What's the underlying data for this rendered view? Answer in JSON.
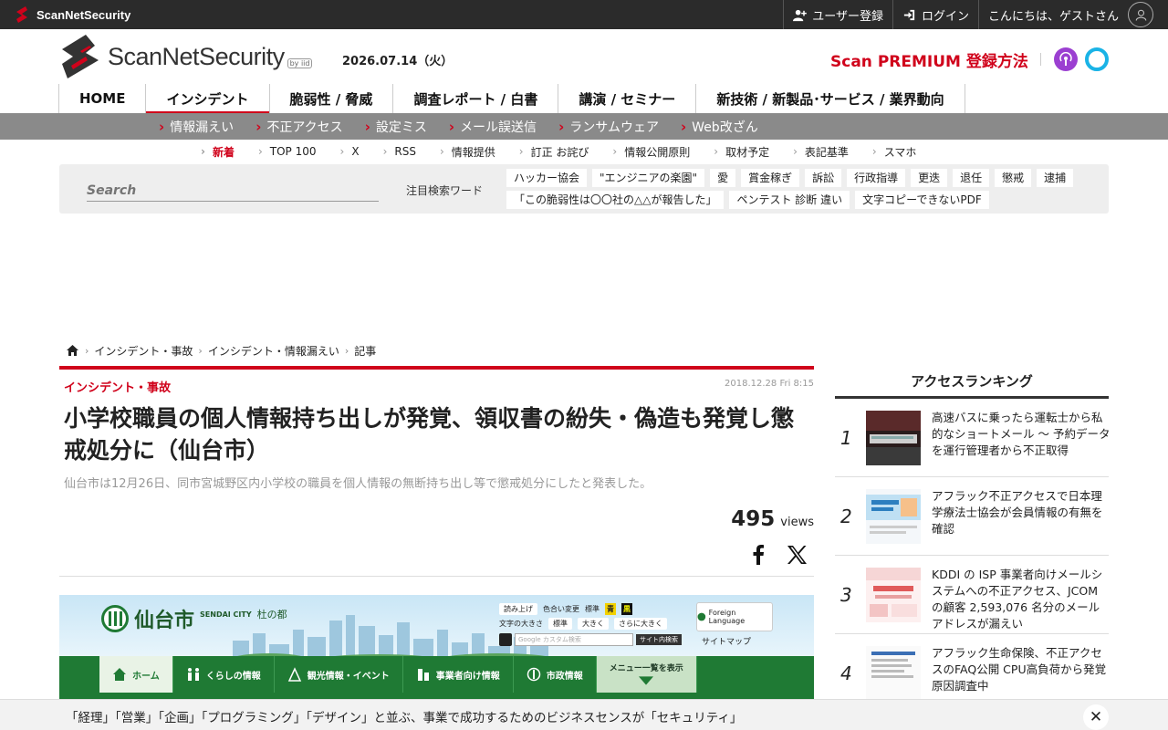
{
  "topbar": {
    "brand": "ScanNetSecurity",
    "register": "ユーザー登録",
    "login": "ログイン",
    "greeting": "こんにちは、ゲストさん"
  },
  "header": {
    "logo_text": "ScanNetSecurity",
    "logo_by": "by iid",
    "date": "2026.07.14（火）",
    "premium": "Scan PREMIUM 登録方法"
  },
  "main_nav": [
    "HOME",
    "インシデント",
    "脆弱性 / 脅威",
    "調査レポート / 白書",
    "講演 / セミナー",
    "新技術 / 新製品･サービス / 業界動向"
  ],
  "sub_nav": [
    "情報漏えい",
    "不正アクセス",
    "設定ミス",
    "メール誤送信",
    "ランサムウェア",
    "Web改ざん"
  ],
  "link_nav": [
    "新着",
    "TOP 100",
    "X",
    "RSS",
    "情報提供",
    "訂正 お詫び",
    "情報公開原則",
    "取材予定",
    "表記基準",
    "スマホ"
  ],
  "search": {
    "placeholder": "Search",
    "keyword_label": "注目検索ワード",
    "keywords": [
      "ハッカー協会",
      "\"エンジニアの楽園\"",
      "愛",
      "賞金稼ぎ",
      "訴訟",
      "行政指導",
      "更迭",
      "退任",
      "懲戒",
      "逮捕",
      "「この脆弱性は〇〇社の△△が報告した」",
      "ペンテスト 診断 違い",
      "文字コピーできないPDF"
    ]
  },
  "breadcrumb": [
    "インシデント・事故",
    "インシデント・情報漏えい",
    "記事"
  ],
  "article": {
    "category": "インシデント・事故",
    "timestamp": "2018.12.28 Fri 8:15",
    "title": "小学校職員の個人情報持ち出しが発覚、領収書の紛失・偽造も発覚し懲戒処分に（仙台市）",
    "lead": "仙台市は12月26日、同市宮城野区内小学校の職員を個人情報の無断持ち出し等で懲戒処分にしたと発表した。",
    "views_count": "495",
    "views_unit": "views"
  },
  "article_image": {
    "city_name": "仙台市",
    "city_en": "SENDAI CITY",
    "city_motto": "杜の都",
    "read_aloud": "読み上げ",
    "color_change": "色合い変更",
    "standard": "標準",
    "yellow": "青",
    "black": "黒",
    "font_size": "文字の大きさ",
    "size_standard": "標準",
    "size_large": "大きく",
    "size_larger": "さらに大きく",
    "search_placeholder": "Google カスタム検索",
    "search_button": "サイト内検索",
    "foreign_language": "Foreign Language",
    "sitemap": "サイトマップ",
    "nav": [
      "ホーム",
      "くらしの情報",
      "観光情報・イベント",
      "事業者向け情報",
      "市政情報",
      "メニュー一覧を表示"
    ]
  },
  "ranking": {
    "title": "アクセスランキング",
    "items": [
      {
        "rank": "1",
        "text": "高速バスに乗ったら運転士から私的なショートメール 〜 予約データを運行管理者から不正取得"
      },
      {
        "rank": "2",
        "text": "アフラック不正アクセスで日本理学療法士協会が会員情報の有無を確認"
      },
      {
        "rank": "3",
        "text": "KDDI の ISP 事業者向けメールシステムへの不正アクセス、JCOM の顧客 2,593,076 名分のメールアドレスが漏えい"
      },
      {
        "rank": "4",
        "text": "アフラック生命保険、不正アクセスのFAQ公開 CPU高負荷から発覚 原因調査中"
      }
    ]
  },
  "banner": {
    "text": "「経理」「営業」「企画」「プログラミング」「デザイン」と並ぶ、事業で成功するためのビジネスセンスが「セキュリティ」"
  },
  "colors": {
    "accent": "#d0021b",
    "topbar": "#2b2b2b",
    "subnav": "#8a8a8a",
    "sendai_green": "#1f7a34"
  }
}
